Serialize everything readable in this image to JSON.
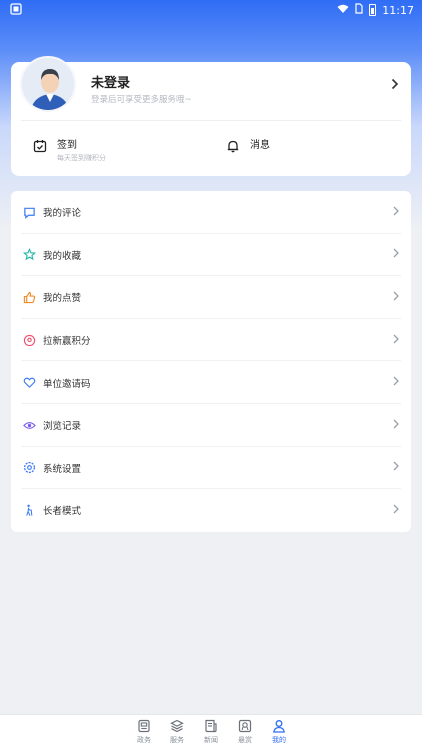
{
  "status_bar": {
    "time": "11:17"
  },
  "profile": {
    "name": "未登录",
    "subtitle": "登录后可享受更多服务哦~",
    "sign_in": {
      "label": "签到",
      "subtitle": "每天签到赚积分"
    },
    "messages": {
      "label": "消息"
    }
  },
  "menu": {
    "items": [
      {
        "label": "我的评论",
        "icon": "comment-icon",
        "color": "#3a7bf5"
      },
      {
        "label": "我的收藏",
        "icon": "star-icon",
        "color": "#1fb7a8"
      },
      {
        "label": "我的点赞",
        "icon": "thumbs-up-icon",
        "color": "#f08a24"
      },
      {
        "label": "拉新赢积分",
        "icon": "location-pin-icon",
        "color": "#f0506e"
      },
      {
        "label": "单位邀请码",
        "icon": "heart-icon",
        "color": "#3a7bf5"
      },
      {
        "label": "浏览记录",
        "icon": "eye-icon",
        "color": "#7a5af5"
      },
      {
        "label": "系统设置",
        "icon": "gear-icon",
        "color": "#3a7bf5"
      },
      {
        "label": "长者模式",
        "icon": "elder-walking-icon",
        "color": "#3a7bf5"
      }
    ]
  },
  "tabbar": {
    "tabs": [
      {
        "label": "政务",
        "icon": "government-icon"
      },
      {
        "label": "服务",
        "icon": "layers-icon"
      },
      {
        "label": "新闻",
        "icon": "news-icon"
      },
      {
        "label": "悬赏",
        "icon": "reward-icon"
      },
      {
        "label": "我的",
        "icon": "user-icon",
        "active": true
      }
    ]
  },
  "colors": {
    "accent": "#2f6df6",
    "background": "#eef0f4"
  }
}
